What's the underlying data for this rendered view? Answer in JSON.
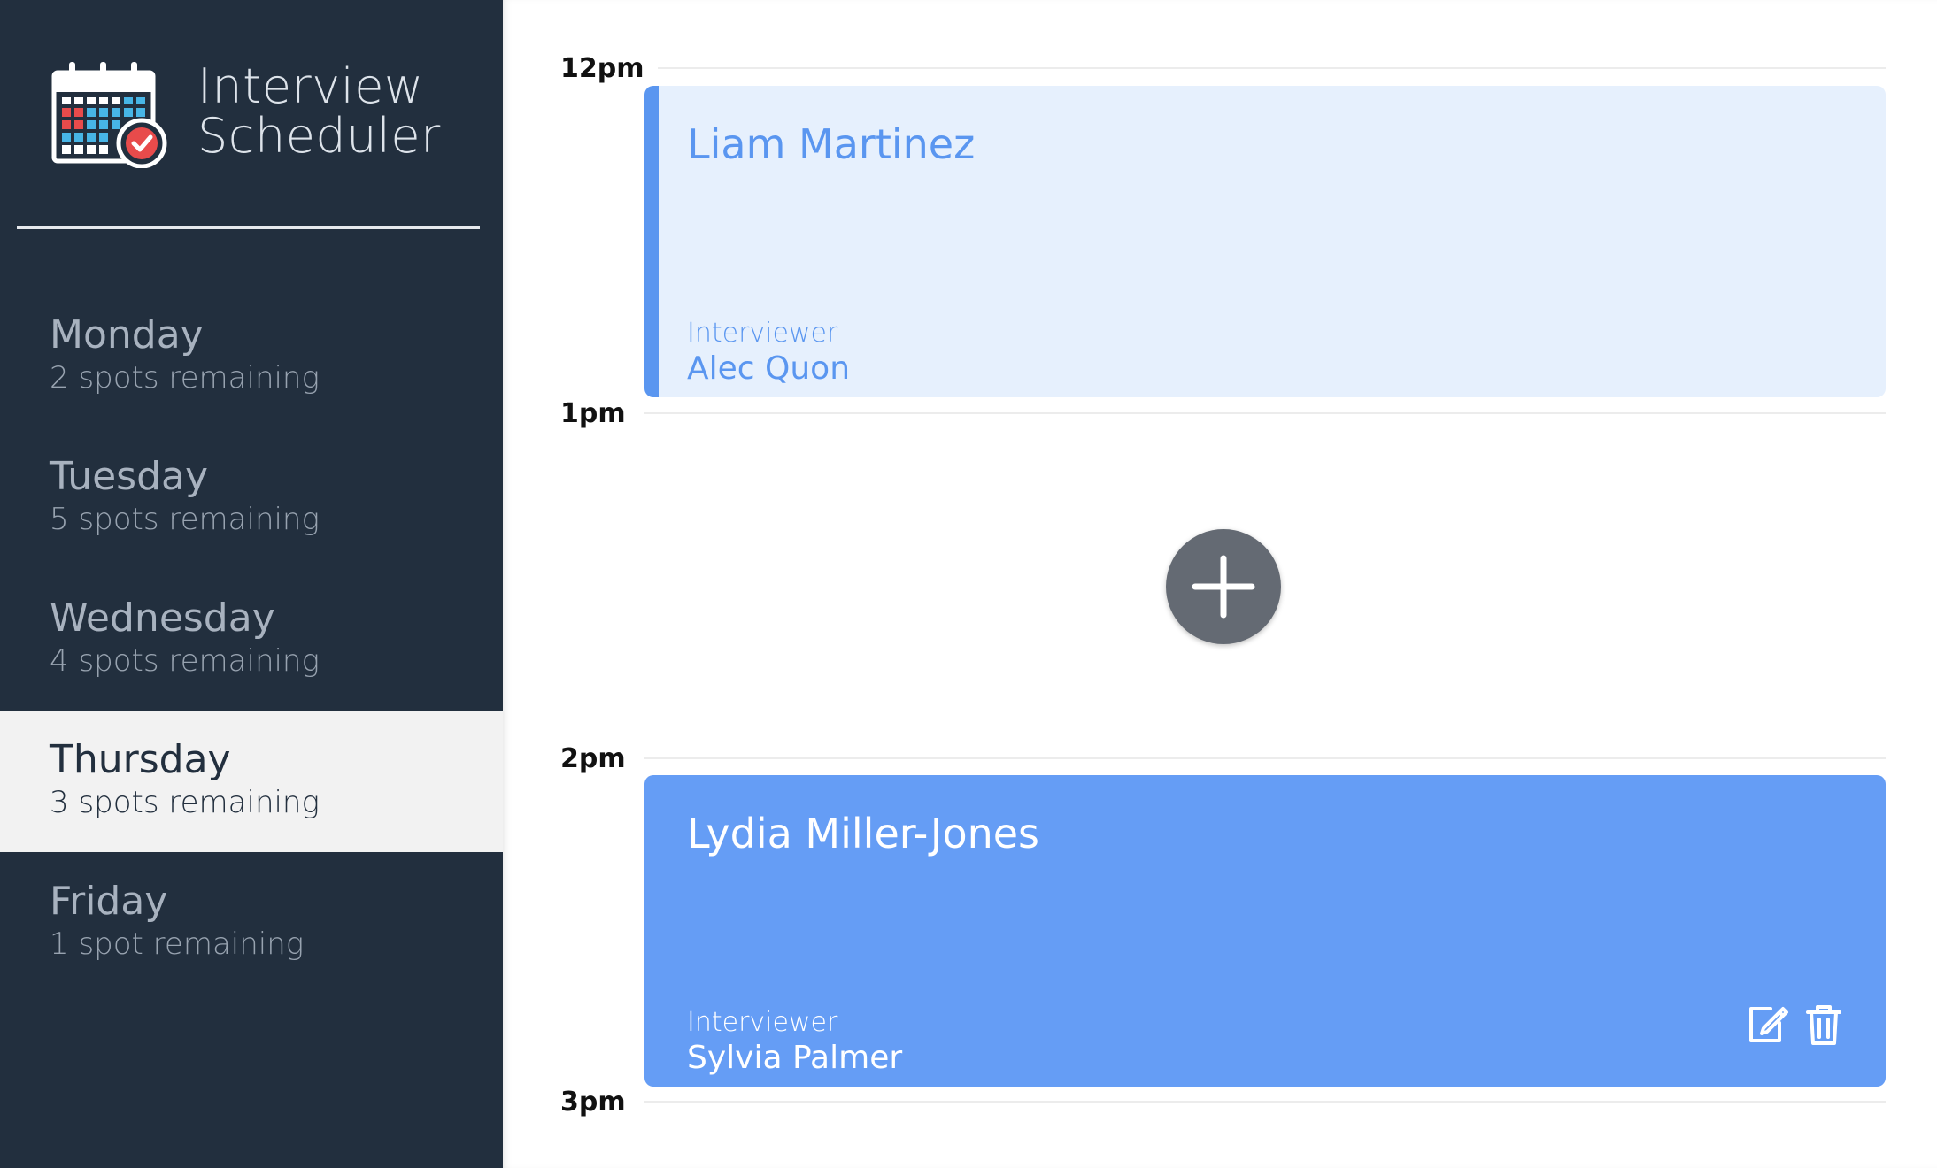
{
  "brand": {
    "title_line1": "Interview",
    "title_line2": "Scheduler",
    "logo_icon": "calendar-check-icon"
  },
  "days": [
    {
      "name": "Monday",
      "spots": "2 spots remaining",
      "selected": false
    },
    {
      "name": "Tuesday",
      "spots": "5 spots remaining",
      "selected": false
    },
    {
      "name": "Wednesday",
      "spots": "4 spots remaining",
      "selected": false
    },
    {
      "name": "Thursday",
      "spots": "3 spots remaining",
      "selected": true
    },
    {
      "name": "Friday",
      "spots": "1 spot remaining",
      "selected": false
    }
  ],
  "schedule": {
    "times": [
      "12pm",
      "1pm",
      "2pm",
      "3pm"
    ],
    "appointments": [
      {
        "student": "Liam Martinez",
        "interviewer_label": "Interviewer",
        "interviewer": "Alec Quon"
      },
      {
        "student": "Lydia Miller-Jones",
        "interviewer_label": "Interviewer",
        "interviewer": "Sylvia Palmer"
      }
    ],
    "empty_slot_icon": "plus-icon",
    "action_icons": [
      "edit-icon",
      "trash-icon"
    ]
  },
  "colors": {
    "sidebar_bg": "#222f3e",
    "selected_day_bg": "#f2f2f2",
    "appointment_light_bg": "#e6f0fd",
    "appointment_accent": "#5a96f0",
    "appointment_dark_bg": "#659df5",
    "add_button_bg": "#646a73"
  }
}
